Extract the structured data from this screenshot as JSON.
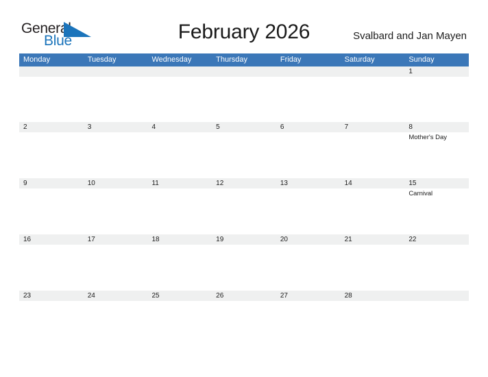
{
  "brand": {
    "name_part1": "General",
    "name_part2": "Blue",
    "flag_icon": "blue-triangle-flag-icon",
    "color_dark": "#231f20",
    "color_blue": "#1b74bb"
  },
  "header": {
    "title": "February 2026",
    "location": "Svalbard and Jan Mayen"
  },
  "theme": {
    "header_blue": "#3b77b8",
    "rule_blue": "#2e6da4",
    "daybar_gray": "#eff0f0",
    "page_background": "#ffffff",
    "text_color": "#1a1a1a"
  },
  "calendar": {
    "month": "February",
    "year": "2026",
    "weekday_headers": [
      "Monday",
      "Tuesday",
      "Wednesday",
      "Thursday",
      "Friday",
      "Saturday",
      "Sunday"
    ],
    "weeks": [
      {
        "days": [
          {
            "date": "",
            "events": []
          },
          {
            "date": "",
            "events": []
          },
          {
            "date": "",
            "events": []
          },
          {
            "date": "",
            "events": []
          },
          {
            "date": "",
            "events": []
          },
          {
            "date": "",
            "events": []
          },
          {
            "date": "1",
            "events": []
          }
        ]
      },
      {
        "days": [
          {
            "date": "2",
            "events": []
          },
          {
            "date": "3",
            "events": []
          },
          {
            "date": "4",
            "events": []
          },
          {
            "date": "5",
            "events": []
          },
          {
            "date": "6",
            "events": []
          },
          {
            "date": "7",
            "events": []
          },
          {
            "date": "8",
            "events": [
              "Mother's Day"
            ]
          }
        ]
      },
      {
        "days": [
          {
            "date": "9",
            "events": []
          },
          {
            "date": "10",
            "events": []
          },
          {
            "date": "11",
            "events": []
          },
          {
            "date": "12",
            "events": []
          },
          {
            "date": "13",
            "events": []
          },
          {
            "date": "14",
            "events": []
          },
          {
            "date": "15",
            "events": [
              "Carnival"
            ]
          }
        ]
      },
      {
        "days": [
          {
            "date": "16",
            "events": []
          },
          {
            "date": "17",
            "events": []
          },
          {
            "date": "18",
            "events": []
          },
          {
            "date": "19",
            "events": []
          },
          {
            "date": "20",
            "events": []
          },
          {
            "date": "21",
            "events": []
          },
          {
            "date": "22",
            "events": []
          }
        ]
      },
      {
        "days": [
          {
            "date": "23",
            "events": []
          },
          {
            "date": "24",
            "events": []
          },
          {
            "date": "25",
            "events": []
          },
          {
            "date": "26",
            "events": []
          },
          {
            "date": "27",
            "events": []
          },
          {
            "date": "28",
            "events": []
          },
          {
            "date": "",
            "events": []
          }
        ]
      }
    ]
  }
}
